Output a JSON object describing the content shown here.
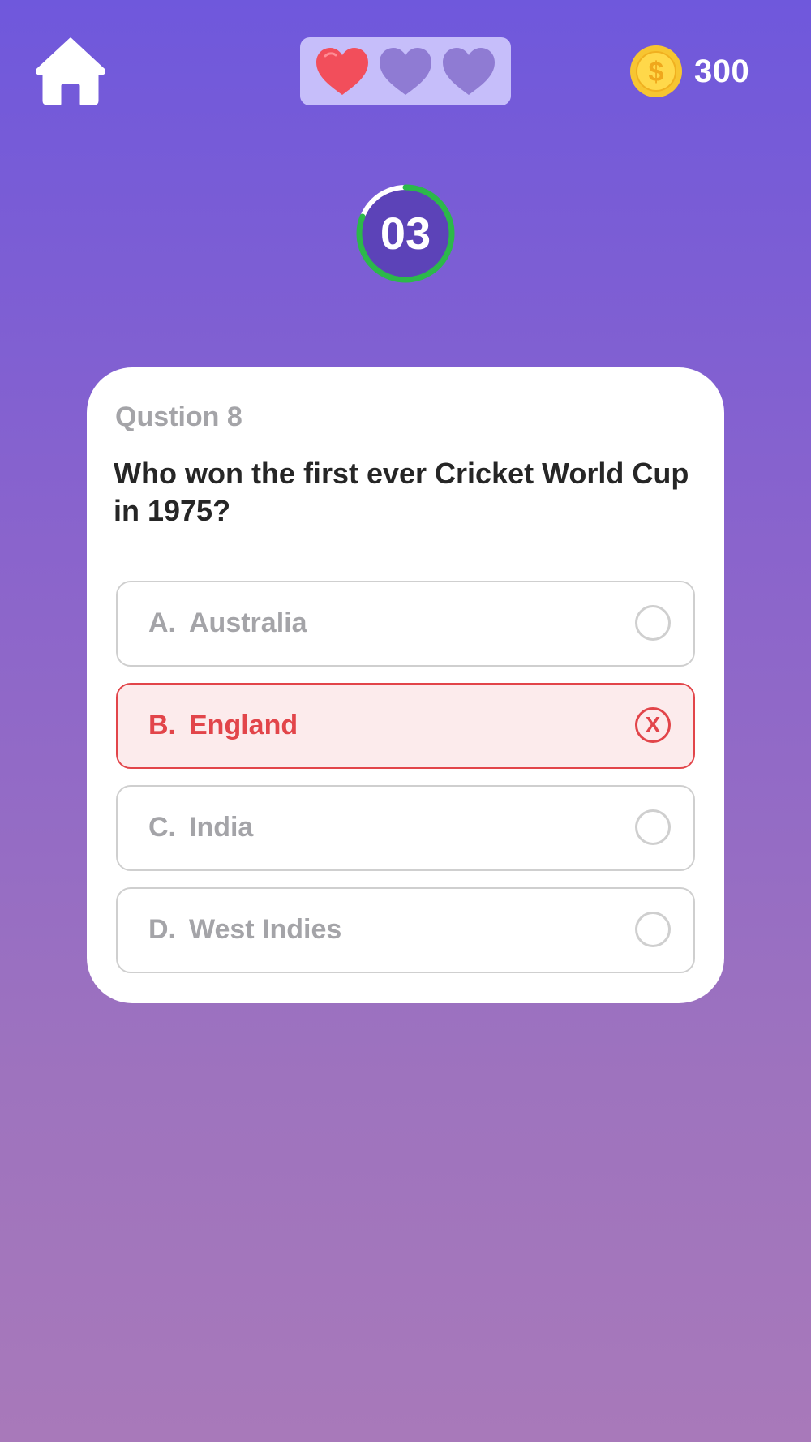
{
  "header": {
    "lives": [
      {
        "state": "full",
        "color": "#f24e5b"
      },
      {
        "state": "empty",
        "color": "#8f7bd3"
      },
      {
        "state": "empty",
        "color": "#8f7bd3"
      }
    ],
    "coins": "300"
  },
  "timer": {
    "value": "03",
    "ring_color": "#2cb84a"
  },
  "question": {
    "number_label": "Qustion 8",
    "text": "Who won the first ever Cricket World Cup in 1975?"
  },
  "options": [
    {
      "letter": "A.",
      "text": "Australia",
      "state": "unselected"
    },
    {
      "letter": "B.",
      "text": "England",
      "state": "wrong",
      "mark": "X"
    },
    {
      "letter": "C.",
      "text": "India",
      "state": "unselected"
    },
    {
      "letter": "D.",
      "text": "West Indies",
      "state": "unselected"
    }
  ],
  "colors": {
    "accent_wrong": "#e2454a",
    "card_bg": "#ffffff",
    "lives_bg": "#c6befa",
    "coin": "#f7c531"
  }
}
